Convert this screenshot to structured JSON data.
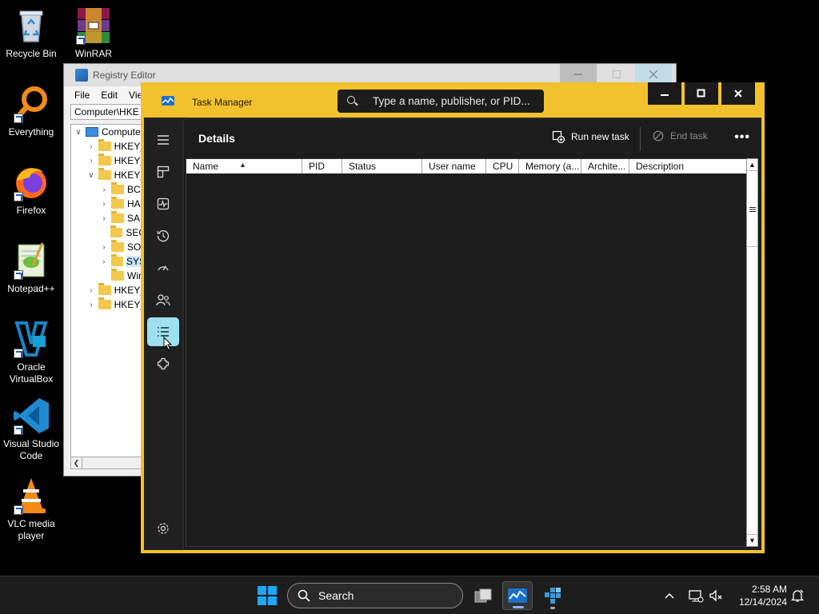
{
  "desktop": {
    "icons": [
      {
        "label": "Recycle Bin",
        "icon": "recycle-bin-icon"
      },
      {
        "label": "WinRAR",
        "icon": "winrar-icon"
      },
      {
        "label": "Everything",
        "icon": "everything-search-icon"
      },
      {
        "label": "Firefox",
        "icon": "firefox-icon"
      },
      {
        "label": "Notepad++",
        "icon": "notepadpp-icon"
      },
      {
        "label": "Oracle\nVirtualBox",
        "icon": "virtualbox-icon"
      },
      {
        "label": "Visual Studio\nCode",
        "icon": "vscode-icon"
      },
      {
        "label": "VLC media\nplayer",
        "icon": "vlc-icon"
      }
    ]
  },
  "regedit": {
    "title": "Registry Editor",
    "menu": [
      "File",
      "Edit",
      "Vie"
    ],
    "address": "Computer\\HKE",
    "tree": [
      {
        "label": "Compute",
        "level": 0,
        "type": "computer",
        "twisty": "v"
      },
      {
        "label": "HKEY_",
        "level": 1,
        "type": "folder",
        "twisty": ">"
      },
      {
        "label": "HKEY_",
        "level": 1,
        "type": "folder",
        "twisty": ">"
      },
      {
        "label": "HKEY_",
        "level": 1,
        "type": "folder",
        "twisty": "v"
      },
      {
        "label": "BC",
        "level": 2,
        "type": "folder",
        "twisty": ">"
      },
      {
        "label": "HA",
        "level": 2,
        "type": "folder",
        "twisty": ">"
      },
      {
        "label": "SAI",
        "level": 2,
        "type": "folder",
        "twisty": ">"
      },
      {
        "label": "SEC",
        "level": 2,
        "type": "folder",
        "twisty": ""
      },
      {
        "label": "SO",
        "level": 2,
        "type": "folder",
        "twisty": ">"
      },
      {
        "label": "SYS",
        "level": 2,
        "type": "folder",
        "twisty": ">",
        "selected": true
      },
      {
        "label": "Wir",
        "level": 2,
        "type": "folder",
        "twisty": ""
      },
      {
        "label": "HKEY_",
        "level": 1,
        "type": "folder",
        "twisty": ">"
      },
      {
        "label": "HKEY_",
        "level": 1,
        "type": "folder",
        "twisty": ">"
      }
    ]
  },
  "taskmgr": {
    "title": "Task Manager",
    "search_placeholder": "Type a name, publisher, or PID...",
    "page_title": "Details",
    "run_new_task": "Run new task",
    "end_task": "End task",
    "more": "•••",
    "columns": [
      "Name",
      "PID",
      "Status",
      "User name",
      "CPU",
      "Memory (a...",
      "Archite...",
      "Description"
    ],
    "sorted_column": "Name",
    "nav": [
      {
        "name": "hamburger-menu-icon"
      },
      {
        "name": "processes-icon"
      },
      {
        "name": "performance-icon"
      },
      {
        "name": "app-history-icon"
      },
      {
        "name": "startup-apps-icon"
      },
      {
        "name": "users-icon"
      },
      {
        "name": "details-icon",
        "active": true
      },
      {
        "name": "services-icon"
      },
      {
        "name": "settings-icon"
      }
    ],
    "accent_color": "#f2c12e",
    "active_nav_color": "#9fe0ee"
  },
  "taskbar": {
    "search_label": "Search",
    "time": "2:58 AM",
    "date": "12/14/2024"
  }
}
